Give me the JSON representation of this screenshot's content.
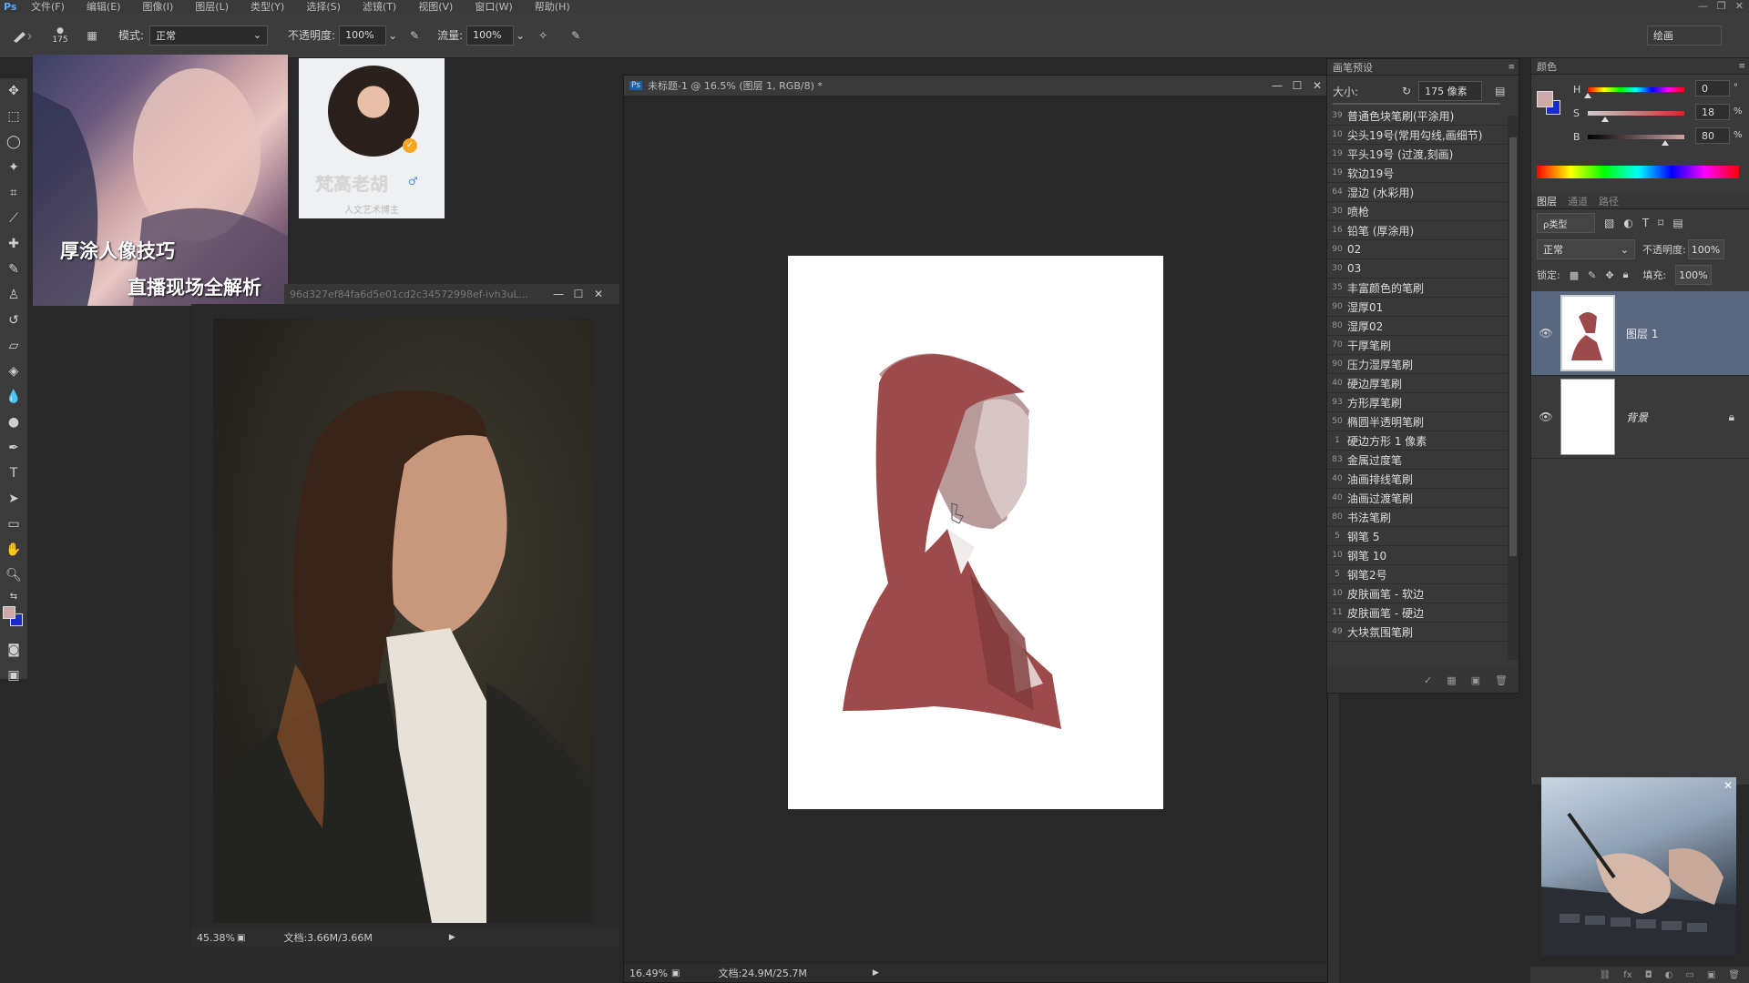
{
  "menubar": {
    "logo": "Ps",
    "items": [
      "文件(F)",
      "编辑(E)",
      "图像(I)",
      "图层(L)",
      "类型(Y)",
      "选择(S)",
      "滤镜(T)",
      "视图(V)",
      "窗口(W)",
      "帮助(H)"
    ]
  },
  "options": {
    "brush_size": "175",
    "mode_label": "模式:",
    "mode_value": "正常",
    "opacity_label": "不透明度:",
    "opacity_value": "100%",
    "flow_label": "流量:",
    "flow_value": "100%",
    "workspace": "绘画"
  },
  "promo": {
    "line1": "厚涂人像技巧",
    "line2": "直播现场全解析"
  },
  "profile": {
    "name": "梵高老胡",
    "subtitle": "人文艺术博主"
  },
  "ref_window": {
    "title": "96d327ef84fa6d5e01cd2c34572998ef-ivh3uL...",
    "zoom": "45.38%",
    "doc": "文档:3.66M/3.66M"
  },
  "canvas_window": {
    "title": "未标题-1 @ 16.5% (图层 1, RGB/8) *",
    "zoom": "16.49%",
    "doc": "文档:24.9M/25.7M"
  },
  "brush_panel": {
    "title": "画笔预设",
    "size_label": "大小:",
    "size_value": "175 像素",
    "brushes": [
      {
        "size": "39",
        "name": "普通色块笔刷(平涂用)"
      },
      {
        "size": "10",
        "name": "尖头19号(常用勾线,画细节)"
      },
      {
        "size": "19",
        "name": "平头19号 (过渡,刻画)"
      },
      {
        "size": "19",
        "name": "软边19号"
      },
      {
        "size": "64",
        "name": "湿边 (水彩用)"
      },
      {
        "size": "30",
        "name": "喷枪"
      },
      {
        "size": "16",
        "name": "铅笔 (厚涂用)"
      },
      {
        "size": "90",
        "name": "02"
      },
      {
        "size": "30",
        "name": "03"
      },
      {
        "size": "35",
        "name": "丰富颜色的笔刷"
      },
      {
        "size": "90",
        "name": "湿厚01"
      },
      {
        "size": "80",
        "name": "湿厚02"
      },
      {
        "size": "70",
        "name": "干厚笔刷"
      },
      {
        "size": "90",
        "name": "压力湿厚笔刷"
      },
      {
        "size": "40",
        "name": "硬边厚笔刷"
      },
      {
        "size": "93",
        "name": "方形厚笔刷"
      },
      {
        "size": "50",
        "name": "椭圆半透明笔刷"
      },
      {
        "size": "1",
        "name": "硬边方形 1 像素"
      },
      {
        "size": "83",
        "name": "金属过度笔"
      },
      {
        "size": "40",
        "name": "油画排线笔刷"
      },
      {
        "size": "40",
        "name": "油画过渡笔刷"
      },
      {
        "size": "80",
        "name": "书法笔刷"
      },
      {
        "size": "5",
        "name": "钢笔 5"
      },
      {
        "size": "10",
        "name": "钢笔 10"
      },
      {
        "size": "5",
        "name": "钢笔2号"
      },
      {
        "size": "10",
        "name": "皮肤画笔 - 软边"
      },
      {
        "size": "11",
        "name": "皮肤画笔 - 硬边"
      },
      {
        "size": "49",
        "name": "大块氛围笔刷"
      }
    ]
  },
  "color_panel": {
    "tab": "颜色",
    "h_label": "H",
    "h_value": "0",
    "h_unit": "°",
    "s_label": "S",
    "s_value": "18",
    "s_unit": "%",
    "b_label": "B",
    "b_value": "80",
    "b_unit": "%",
    "h_fraction": 0.0,
    "s_fraction": 0.18,
    "b_fraction": 0.8
  },
  "layers_panel": {
    "tabs": [
      "图层",
      "通道",
      "路径"
    ],
    "kind_label": "ρ类型",
    "blend_mode": "正常",
    "opacity_label": "不透明度:",
    "opacity_value": "100%",
    "lock_label": "锁定:",
    "fill_label": "填充:",
    "fill_value": "100%",
    "layers": [
      {
        "name": "图层 1"
      },
      {
        "name": "背景"
      }
    ]
  },
  "colors": {
    "foreground": "#cfa8a8",
    "background": "#1a2bd1",
    "paint": "#9e4a4a"
  }
}
